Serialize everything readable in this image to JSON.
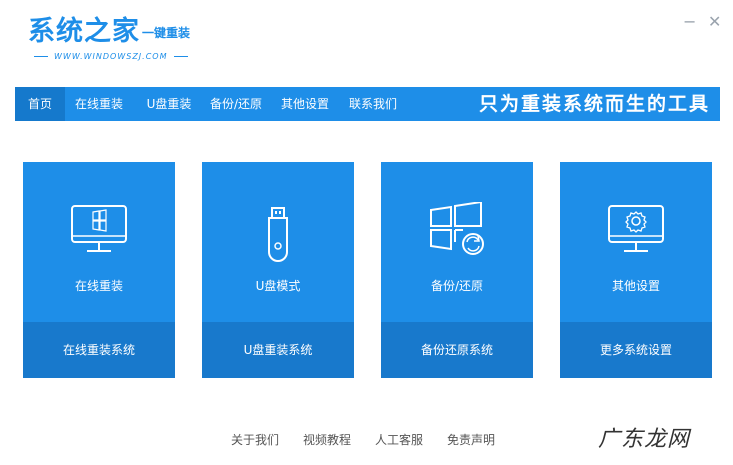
{
  "logo": {
    "title": "系统之家",
    "subtitle": "一键重装",
    "url": "WWW.WINDOWSZJ.COM"
  },
  "window": {
    "minimize": "−",
    "close": "✕"
  },
  "nav": {
    "items": [
      "首页",
      "在线重装",
      "U盘重装",
      "备份/还原",
      "其他设置",
      "联系我们"
    ],
    "active_index": 0,
    "slogan": "只为重装系统而生的工具"
  },
  "cards": [
    {
      "label": "在线重装",
      "action": "在线重装系统",
      "icon": "monitor-windows-icon"
    },
    {
      "label": "U盘模式",
      "action": "U盘重装系统",
      "icon": "usb-drive-icon"
    },
    {
      "label": "备份/还原",
      "action": "备份还原系统",
      "icon": "windows-refresh-icon"
    },
    {
      "label": "其他设置",
      "action": "更多系统设置",
      "icon": "monitor-gear-icon"
    }
  ],
  "footer": {
    "links": [
      "关于我们",
      "视频教程",
      "人工客服",
      "免责声明"
    ]
  },
  "watermark": "广东龙网",
  "colors": {
    "brand": "#1e8ee8",
    "brand_dark": "#1879cc"
  }
}
